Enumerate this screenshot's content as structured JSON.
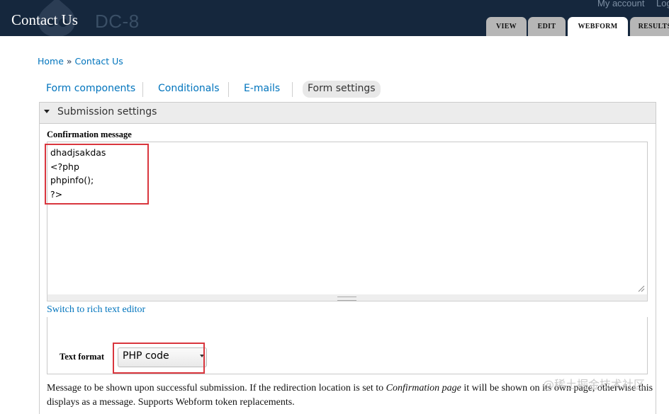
{
  "header": {
    "page_title": "Contact Us",
    "site_name": "DC-8",
    "account_link": "My account",
    "logout_link": "Log out"
  },
  "primary_tabs": [
    {
      "label": "VIEW",
      "active": false
    },
    {
      "label": "EDIT",
      "active": false
    },
    {
      "label": "WEBFORM",
      "active": true
    },
    {
      "label": "RESULTS",
      "active": false
    }
  ],
  "breadcrumb": {
    "home": "Home",
    "separator": "»",
    "current": "Contact Us"
  },
  "secondary_tabs": [
    {
      "label": "Form components",
      "active": false
    },
    {
      "label": "Conditionals",
      "active": false
    },
    {
      "label": "E-mails",
      "active": false
    },
    {
      "label": "Form settings",
      "active": true
    }
  ],
  "submission_settings": {
    "legend": "Submission settings",
    "confirmation_label": "Confirmation message",
    "confirmation_lines": [
      "dhadjsakdas",
      "<?php",
      "phpinfo();",
      "?>"
    ],
    "switch_editor_link": "Switch to rich text editor",
    "text_format_label": "Text format",
    "text_format_value": "PHP code",
    "description_part1": "Message to be shown upon successful submission. If the redirection location is set to ",
    "description_em": "Confirmation page",
    "description_part2": " it will be shown on its own page, otherwise this displays as a message. Supports Webform token replacements."
  },
  "watermark": "@稀土掘金技术社区",
  "colors": {
    "header_bg": "#15273d",
    "link": "#0074bd",
    "highlight_box": "#d9363e",
    "tab_inactive": "#b6b6b6"
  }
}
